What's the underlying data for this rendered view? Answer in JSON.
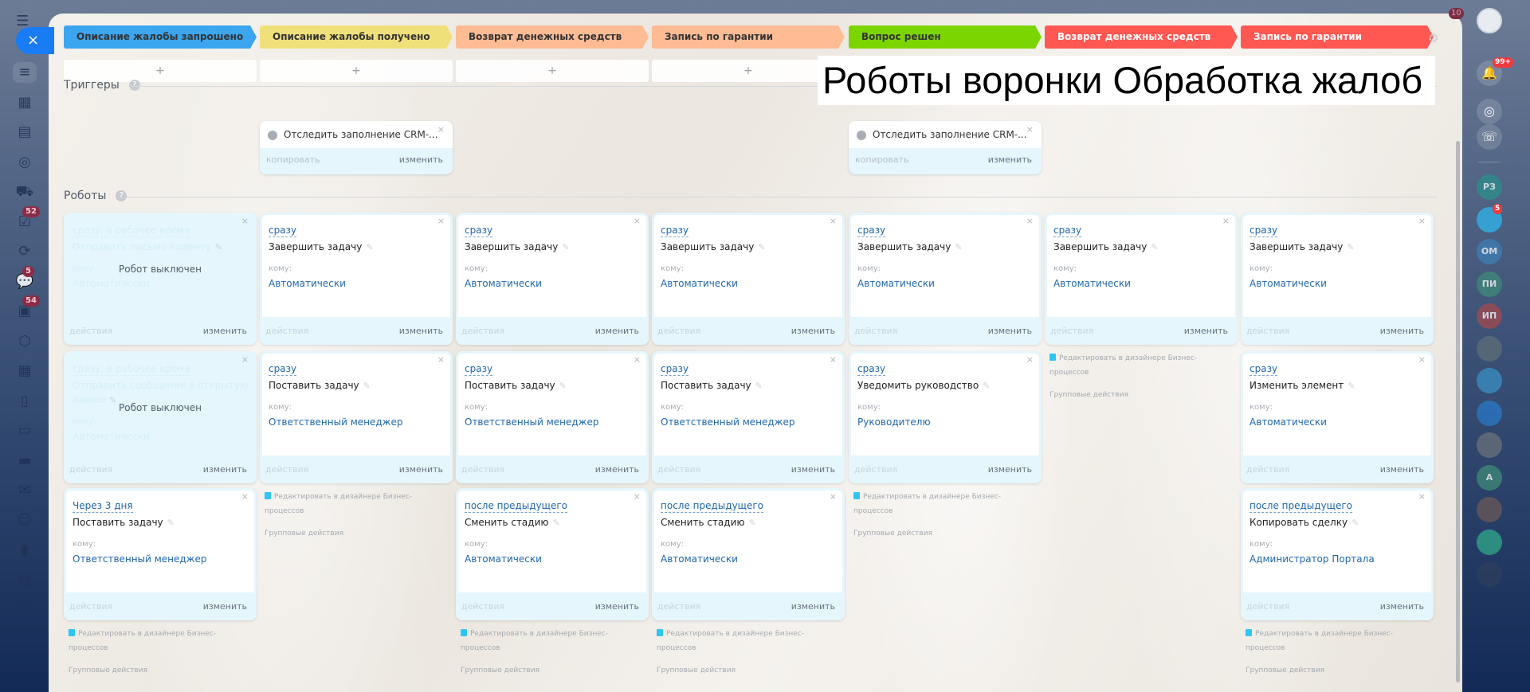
{
  "page_title": "Роботы воронки Обработка жалоб",
  "close_label": "×",
  "sections": {
    "triggers": "Триггеры",
    "robots": "Роботы"
  },
  "stages": [
    {
      "label": "Описание жалобы запрошено",
      "color": "#3ba5ef",
      "text": "#333333"
    },
    {
      "label": "Описание жалобы получено",
      "color": "#f0e07a",
      "text": "#333333"
    },
    {
      "label": "Возврат денежных средств",
      "color": "#ffbb94",
      "text": "#333333"
    },
    {
      "label": "Запись по гарантии",
      "color": "#ffbb94",
      "text": "#333333"
    },
    {
      "label": "Вопрос решен",
      "color": "#7bd500",
      "text": "#333333"
    },
    {
      "label": "Возврат денежных средств",
      "color": "#ff5752",
      "text": "#ffffff"
    },
    {
      "label": "Запись по гарантии",
      "color": "#ff5752",
      "text": "#ffffff"
    }
  ],
  "plus": "+",
  "labels": {
    "copy": "копировать",
    "edit": "изменить",
    "actions": "действия",
    "to": "кому:",
    "robot_off": "Робот выключен",
    "bp_edit": "Редактировать в дизайнере Бизнес-процессов",
    "group_actions": "Групповые действия",
    "close": "×",
    "pencil": "✎"
  },
  "columns": [
    {
      "triggers": [],
      "robots": [
        {
          "when": "сразу, в рабочее время",
          "name": "Отправить письмо клиенту",
          "to": "Автоматически",
          "disabled": true
        },
        {
          "when": "сразу, в рабочее время",
          "name": "Отправить сообщение в открытую линию",
          "to": "Автоматически",
          "disabled": true
        },
        {
          "when": "Через 3 дня",
          "name": "Поставить задачу",
          "to": "Ответственный менеджер"
        }
      ]
    },
    {
      "triggers": [
        "Отследить заполнение CRM-..."
      ],
      "robots": [
        {
          "when": "сразу",
          "name": "Завершить задачу",
          "to": "Автоматически"
        },
        {
          "when": "сразу",
          "name": "Поставить задачу",
          "to": "Ответственный менеджер"
        }
      ]
    },
    {
      "triggers": [],
      "robots": [
        {
          "when": "сразу",
          "name": "Завершить задачу",
          "to": "Автоматически"
        },
        {
          "when": "сразу",
          "name": "Поставить задачу",
          "to": "Ответственный менеджер"
        },
        {
          "when": "после предыдущего",
          "name": "Сменить стадию",
          "to": "Автоматически"
        }
      ]
    },
    {
      "triggers": [],
      "robots": [
        {
          "when": "сразу",
          "name": "Завершить задачу",
          "to": "Автоматически"
        },
        {
          "when": "сразу",
          "name": "Поставить задачу",
          "to": "Ответственный менеджер"
        },
        {
          "when": "после предыдущего",
          "name": "Сменить стадию",
          "to": "Автоматически"
        }
      ]
    },
    {
      "triggers": [
        "Отследить заполнение CRM-..."
      ],
      "robots": [
        {
          "when": "сразу",
          "name": "Завершить задачу",
          "to": "Автоматически"
        },
        {
          "when": "сразу",
          "name": "Уведомить руководство",
          "to": "Руководителю"
        }
      ]
    },
    {
      "triggers": [],
      "robots": [
        {
          "when": "сразу",
          "name": "Завершить задачу",
          "to": "Автоматически"
        }
      ]
    },
    {
      "triggers": [],
      "robots": [
        {
          "when": "сразу",
          "name": "Завершить задачу",
          "to": "Автоматически"
        },
        {
          "when": "сразу",
          "name": "Изменить элемент",
          "to": "Автоматически"
        },
        {
          "when": "после предыдущего",
          "name": "Копировать сделку",
          "to": "Администратор Портала"
        }
      ]
    }
  ],
  "left_sidebar": [
    {
      "icon": "funnel-icon",
      "glyph": "≡",
      "badge": null
    },
    {
      "icon": "calendar-icon",
      "glyph": "▦",
      "badge": null
    },
    {
      "icon": "storage-icon",
      "glyph": "▤",
      "badge": null
    },
    {
      "icon": "target-icon",
      "glyph": "◎",
      "badge": null
    },
    {
      "icon": "cart-icon",
      "glyph": "⛟",
      "badge": null
    },
    {
      "icon": "tasks-icon",
      "glyph": "☑",
      "badge": "52"
    },
    {
      "icon": "flow-icon",
      "glyph": "⟳",
      "badge": null
    },
    {
      "icon": "chat-icon",
      "glyph": "💬",
      "badge": "5"
    },
    {
      "icon": "feed-icon",
      "glyph": "▣",
      "badge": "54"
    },
    {
      "icon": "hexagon-icon",
      "glyph": "⬡",
      "badge": null
    },
    {
      "icon": "calendar2-icon",
      "glyph": "▦",
      "badge": null
    },
    {
      "icon": "document-icon",
      "glyph": "▯",
      "badge": null
    },
    {
      "icon": "presentation-icon",
      "glyph": "▭",
      "badge": null
    },
    {
      "icon": "drive-icon",
      "glyph": "▬",
      "badge": null
    },
    {
      "icon": "mail-icon",
      "glyph": "✉",
      "badge": null
    },
    {
      "icon": "users-icon",
      "glyph": "☺",
      "badge": null
    },
    {
      "icon": "analytics-icon",
      "glyph": "▮",
      "badge": null
    },
    {
      "icon": "contact-card-icon",
      "glyph": "▤",
      "badge": null
    },
    {
      "icon": "settings-icon",
      "glyph": "⚙",
      "badge": null
    }
  ],
  "right_sidebar": {
    "notifications_badge": "99+",
    "top_badge": "10",
    "chats": [
      {
        "label": "РЗ",
        "color": "#2c8f8c",
        "badge": null
      },
      {
        "label": "",
        "color": "#2fb5ee",
        "badge": "5"
      },
      {
        "label": "ОМ",
        "color": "#3e7fb5",
        "badge": null
      },
      {
        "label": "ПИ",
        "color": "#3f8a78",
        "badge": null
      },
      {
        "label": "ИП",
        "color": "#a54a4f",
        "badge": null
      },
      {
        "label": "",
        "color": "#5f6e78",
        "badge": null
      },
      {
        "label": "",
        "color": "#3b8fc4",
        "badge": null
      },
      {
        "label": "",
        "color": "#2a78c6",
        "badge": null
      },
      {
        "label": "",
        "color": "#6a7178",
        "badge": null
      },
      {
        "label": "А",
        "color": "#3f8a78",
        "badge": null
      },
      {
        "label": "",
        "color": "#6b5a55",
        "badge": null
      },
      {
        "label": "",
        "color": "#2fa98a",
        "badge": null
      },
      {
        "label": "",
        "color": "#2d3f5d",
        "badge": null
      }
    ]
  }
}
